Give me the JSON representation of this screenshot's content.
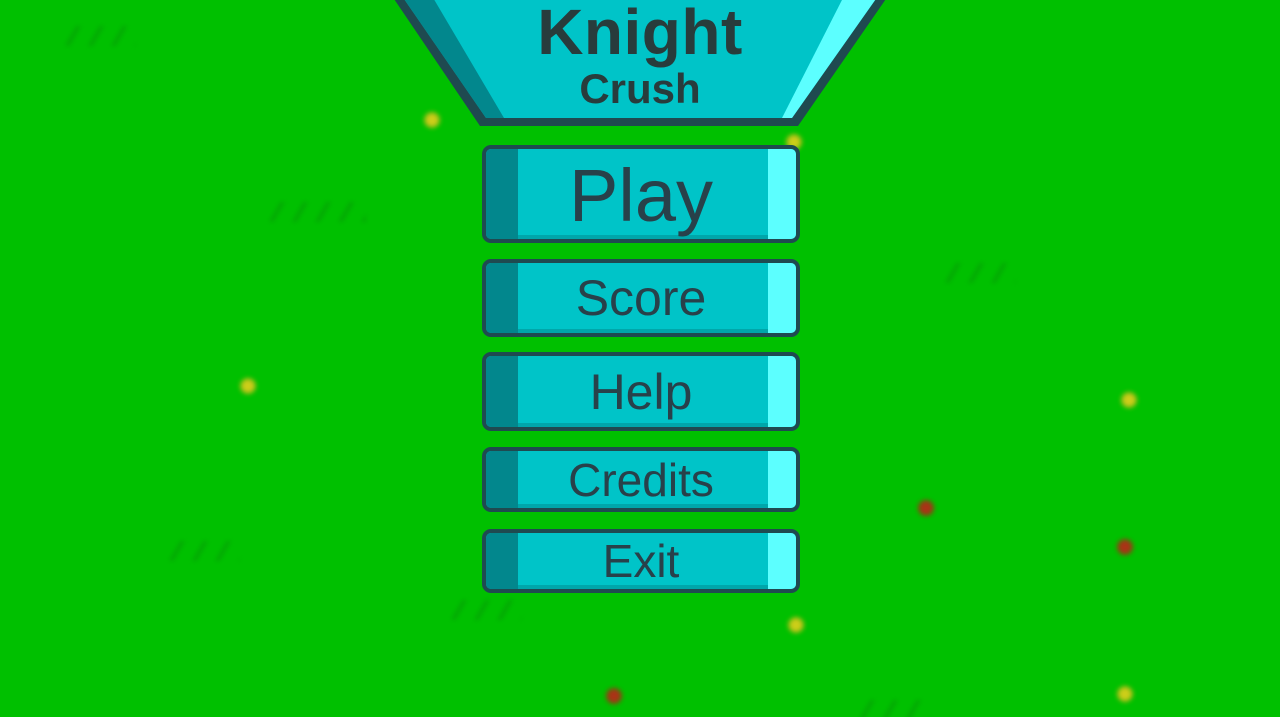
{
  "game": {
    "title": "Knight",
    "subtitle": "Crush"
  },
  "menu": {
    "play_label": "Play",
    "score_label": "Score",
    "help_label": "Help",
    "credits_label": "Credits",
    "exit_label": "Exit"
  },
  "colors": {
    "background_grass": "#00c000",
    "button_face": "#00c4c8",
    "button_shadow_edge": "#02878d",
    "button_highlight_edge": "#5cffff",
    "button_border": "#1f4a50",
    "text": "#283c3c"
  }
}
